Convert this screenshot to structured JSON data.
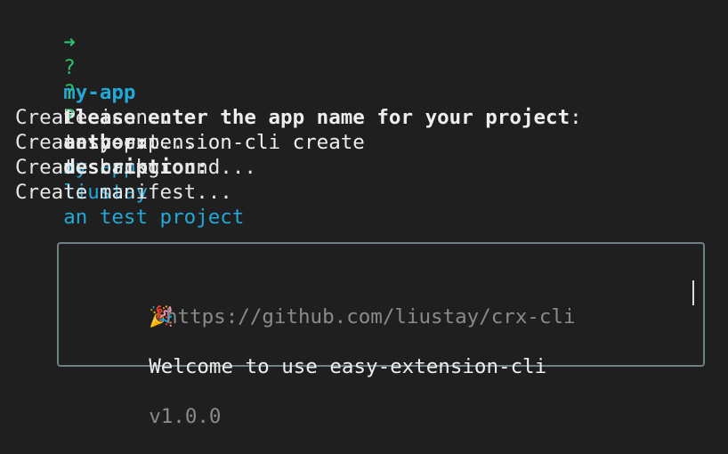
{
  "prompt": {
    "arrow": "➜",
    "dir": "my-app",
    "command": "easy-extension-cli create"
  },
  "questions": [
    {
      "mark": "?",
      "label": "Please enter the app name for your project",
      "separator": ":",
      "answer": "my-app"
    },
    {
      "mark": "?",
      "label": "anthor",
      "separator": ":",
      "answer": "liustay"
    },
    {
      "mark": "?",
      "label": "description",
      "separator": ":",
      "answer": "an test project"
    }
  ],
  "log_lines": [
    "Create icon...",
    "Create popup...",
    "Create background...",
    "Create manifest..."
  ],
  "welcome_box": {
    "emoji": "🎉",
    "text": "Welcome to use easy-extension-cli",
    "version": "v1.0.0",
    "url": "https://github.com/liustay/crx-cli"
  },
  "colors": {
    "background": "#1f1f1f",
    "prompt_arrow": "#2fbf71",
    "answer": "#22a7d6",
    "text": "#e6e6e6",
    "muted": "#8a8a8a",
    "box_border": "#6f7f86"
  }
}
